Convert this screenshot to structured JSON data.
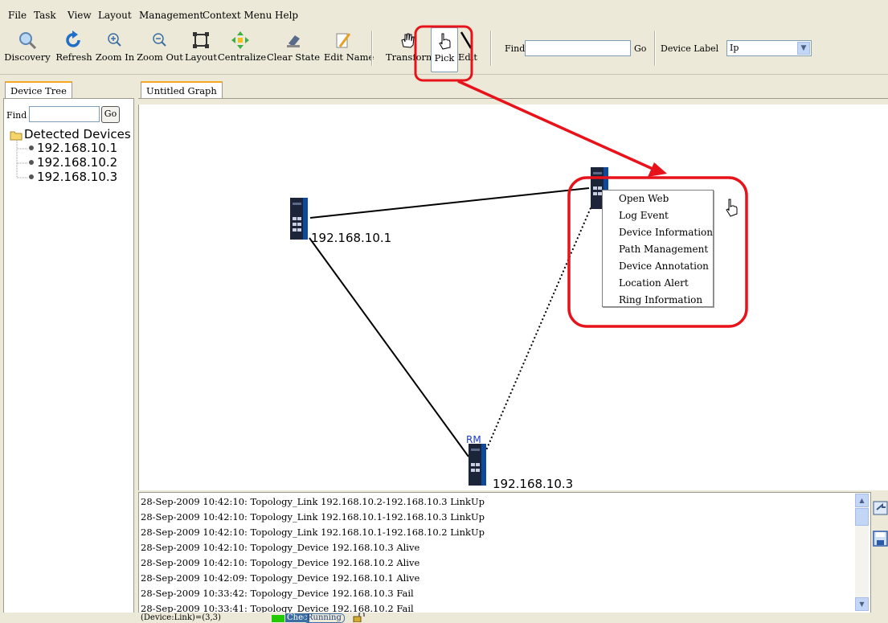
{
  "menu": [
    "File",
    "Task",
    "View",
    "Layout",
    "Management",
    "Context Menu",
    "Help"
  ],
  "toolbar": {
    "buttons": [
      "Discovery",
      "Refresh",
      "Zoom In",
      "Zoom Out",
      "Layout",
      "Centralize",
      "Clear State",
      "Edit Name"
    ],
    "mode_buttons": [
      "Transform",
      "Pick",
      "Edit"
    ],
    "find_label": "Find",
    "find_value": "",
    "go_label": "Go",
    "device_label_label": "Device Label",
    "device_label_value": "Ip"
  },
  "left_panel": {
    "tab": "Device Tree",
    "find_label": "Find",
    "find_value": "",
    "go_label": "Go",
    "root": "Detected Devices",
    "devices": [
      "192.168.10.1",
      "192.168.10.2",
      "192.168.10.3"
    ]
  },
  "graph": {
    "tab": "Untitled Graph",
    "nodes": [
      "192.168.10.1",
      "",
      "192.168.10.3"
    ],
    "rm_badge": "RM"
  },
  "context_menu": [
    "Open Web",
    "Log Event",
    "Device Information",
    "Path Management",
    "Device Annotation",
    "Location Alert",
    "Ring Information"
  ],
  "log": [
    "28-Sep-2009 10:42:10: Topology_Link  192.168.10.2-192.168.10.3 LinkUp",
    "28-Sep-2009 10:42:10: Topology_Link  192.168.10.1-192.168.10.3 LinkUp",
    "28-Sep-2009 10:42:10: Topology_Link  192.168.10.1-192.168.10.2 LinkUp",
    "28-Sep-2009 10:42:10: Topology_Device 192.168.10.3 Alive",
    "28-Sep-2009 10:42:10: Topology_Device 192.168.10.2 Alive",
    "28-Sep-2009 10:42:09: Topology_Device 192.168.10.1 Alive",
    "28-Sep-2009 10:33:42: Topology_Device 192.168.10.3 Fail",
    "28-Sep-2009 10:33:41: Topology_Device 192.168.10.2 Fail"
  ],
  "status": {
    "counts": "(Device:Link)=(3,3)",
    "check": "Chec",
    "running": "Running"
  },
  "colors": {
    "highlight": "#e8121b",
    "tab_accent": "#f5a623",
    "status_green": "#22c800"
  }
}
